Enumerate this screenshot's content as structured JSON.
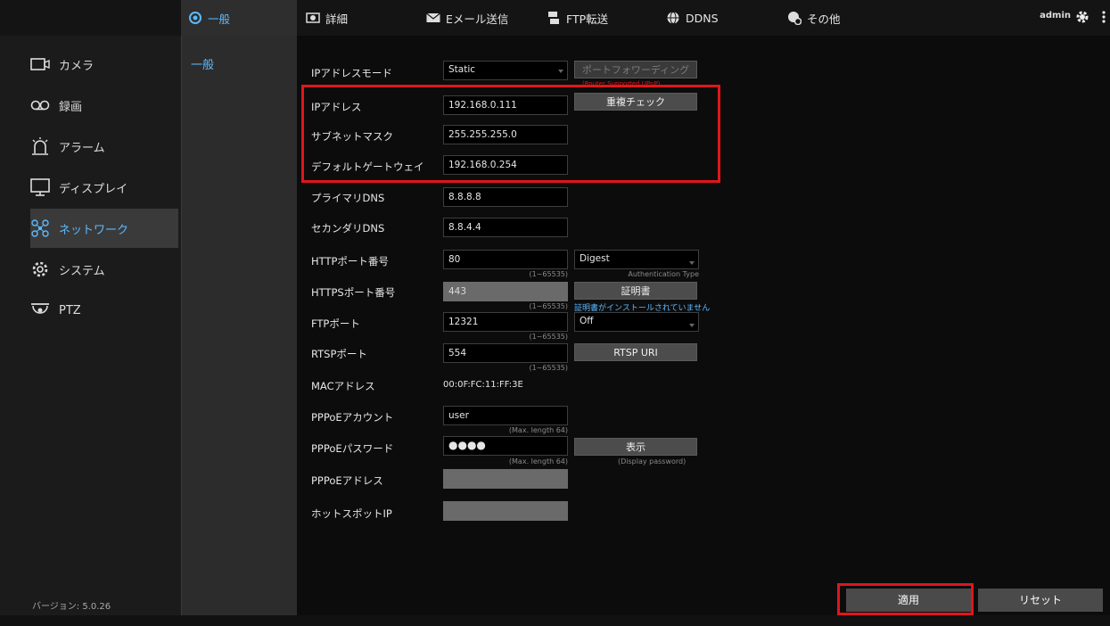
{
  "header": {
    "tabs": [
      {
        "label": "一般",
        "icon": "settings-camera-icon"
      },
      {
        "label": "詳細",
        "icon": "camera-icon"
      },
      {
        "label": "Eメール送信",
        "icon": "mail-icon"
      },
      {
        "label": "FTP転送",
        "icon": "ftp-icon"
      },
      {
        "label": "DDNS",
        "icon": "globe-icon"
      },
      {
        "label": "その他",
        "icon": "globe-gear-icon"
      }
    ],
    "user": "admin"
  },
  "sidebar": {
    "items": [
      {
        "label": "カメラ",
        "icon": "camera-icon"
      },
      {
        "label": "録画",
        "icon": "record-icon"
      },
      {
        "label": "アラーム",
        "icon": "alarm-icon"
      },
      {
        "label": "ディスプレイ",
        "icon": "monitor-icon"
      },
      {
        "label": "ネットワーク",
        "icon": "network-icon"
      },
      {
        "label": "システム",
        "icon": "gear-icon"
      },
      {
        "label": "PTZ",
        "icon": "ptz-icon"
      }
    ],
    "version": "バージョン: 5.0.26"
  },
  "subnav": {
    "item": "一般"
  },
  "form": {
    "ip_mode": {
      "label": "IPアドレスモード",
      "value": "Static",
      "port_forward_button": "ポートフォワーディング",
      "port_forward_hint": "(Router Supported UPnP)"
    },
    "ip_address": {
      "label": "IPアドレス",
      "value": "192.168.0.111",
      "check_button": "重複チェック"
    },
    "subnet": {
      "label": "サブネットマスク",
      "value": "255.255.255.0"
    },
    "gateway": {
      "label": "デフォルトゲートウェイ",
      "value": "192.168.0.254"
    },
    "dns1": {
      "label": "プライマリDNS",
      "value": "8.8.8.8"
    },
    "dns2": {
      "label": "セカンダリDNS",
      "value": "8.8.4.4"
    },
    "http_port": {
      "label": "HTTPポート番号",
      "value": "80",
      "range": "(1~65535)",
      "auth_value": "Digest",
      "auth_hint": "Authentication Type"
    },
    "https_port": {
      "label": "HTTPSポート番号",
      "value": "443",
      "range": "(1~65535)",
      "cert_button": "証明書",
      "cert_note": "証明書がインストールされていません"
    },
    "ftp_port": {
      "label": "FTPポート",
      "value": "12321",
      "range": "(1~65535)",
      "ftp_mode": "Off"
    },
    "rtsp_port": {
      "label": "RTSPポート",
      "value": "554",
      "range": "(1~65535)",
      "rtsp_button": "RTSP URI"
    },
    "mac": {
      "label": "MACアドレス",
      "value": "00:0F:FC:11:FF:3E"
    },
    "pppoe_account": {
      "label": "PPPoEアカウント",
      "value": "user",
      "hint": "(Max. length 64)"
    },
    "pppoe_password": {
      "label": "PPPoEパスワード",
      "value": "●●●●",
      "hint": "(Max. length 64)",
      "show_button": "表示",
      "show_hint": "(Display password)"
    },
    "pppoe_address": {
      "label": "PPPoEアドレス",
      "value": ""
    },
    "hotspot": {
      "label": "ホットスポットIP",
      "value": ""
    }
  },
  "actions": {
    "apply": "適用",
    "reset": "リセット"
  },
  "colors": {
    "accent": "#5db9ff",
    "highlight": "#e0161b"
  }
}
